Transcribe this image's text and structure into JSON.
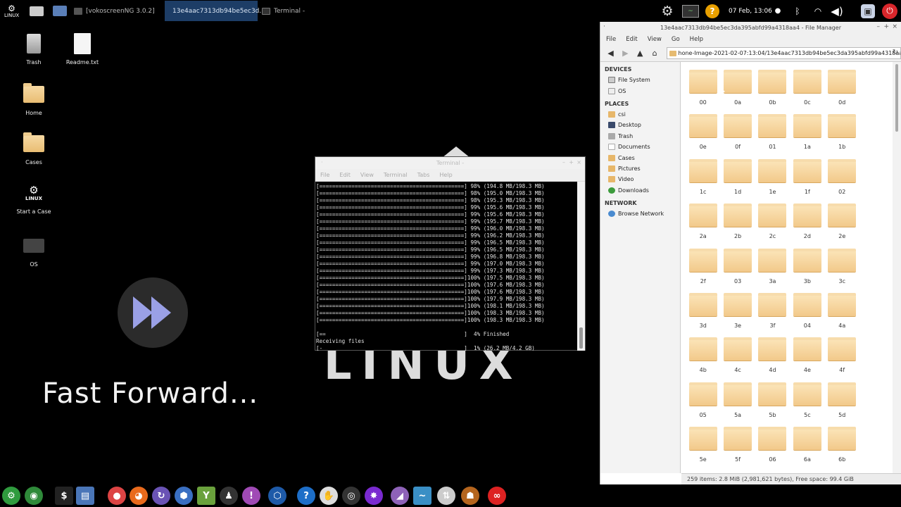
{
  "top_panel": {
    "logo_text": "LINUX",
    "tasks": [
      {
        "label": "[vokoscreenNG 3.0.2]",
        "active": false
      },
      {
        "label": "13e4aac7313db94be5ec3d...",
        "active": true
      },
      {
        "label": "Terminal -",
        "active": false
      }
    ],
    "datetime": "07 Feb, 13:06"
  },
  "desktop_icons": [
    {
      "label": "Trash"
    },
    {
      "label": "Readme.txt"
    },
    {
      "label": "Home"
    },
    {
      "label": "Cases"
    },
    {
      "label": "Start a Case"
    },
    {
      "label": "OS"
    }
  ],
  "overlay": {
    "text": "Fast Forward..."
  },
  "background_logo": "LINUX",
  "terminal": {
    "title": "Terminal -",
    "menu": [
      "File",
      "Edit",
      "View",
      "Terminal",
      "Tabs",
      "Help"
    ],
    "lines": [
      "[=============================================] 98% (194.8 MB/198.3 MB)",
      "[=============================================] 98% (195.0 MB/198.3 MB)",
      "[=============================================] 98% (195.3 MB/198.3 MB)",
      "[=============================================] 99% (195.6 MB/198.3 MB)",
      "[=============================================] 99% (195.6 MB/198.3 MB)",
      "[=============================================] 99% (195.7 MB/198.3 MB)",
      "[=============================================] 99% (196.0 MB/198.3 MB)",
      "[=============================================] 99% (196.2 MB/198.3 MB)",
      "[=============================================] 99% (196.5 MB/198.3 MB)",
      "[=============================================] 99% (196.5 MB/198.3 MB)",
      "[=============================================] 99% (196.8 MB/198.3 MB)",
      "[=============================================] 99% (197.0 MB/198.3 MB)",
      "[=============================================] 99% (197.3 MB/198.3 MB)",
      "[=============================================]100% (197.5 MB/198.3 MB)",
      "[=============================================]100% (197.6 MB/198.3 MB)",
      "[=============================================]100% (197.6 MB/198.3 MB)",
      "[=============================================]100% (197.9 MB/198.3 MB)",
      "[=============================================]100% (198.1 MB/198.3 MB)",
      "[=============================================]100% (198.3 MB/198.3 MB)",
      "[=============================================]100% (198.3 MB/198.3 MB)",
      "",
      "[==                                           ]  4% Finished",
      "Receiving files",
      "[-                                            ]  1% (26.2 MB/4.2 GB)"
    ]
  },
  "file_manager": {
    "title": "13e4aac7313db94be5ec3da395abfd99a4318aa4 - File Manager",
    "menu": [
      "File",
      "Edit",
      "View",
      "Go",
      "Help"
    ],
    "path": "hone-Image-2021-02-07:13:04/13e4aac7313db94be5ec3da395abfd99a4318aa4/",
    "sidebar": {
      "devices_header": "DEVICES",
      "devices": [
        "File System",
        "OS"
      ],
      "places_header": "PLACES",
      "places": [
        "csi",
        "Desktop",
        "Trash",
        "Documents",
        "Cases",
        "Pictures",
        "Video",
        "Downloads"
      ],
      "network_header": "NETWORK",
      "network": [
        "Browse Network"
      ]
    },
    "folders": [
      "00",
      "0a",
      "0b",
      "0c",
      "0d",
      "0e",
      "0f",
      "01",
      "1a",
      "1b",
      "1c",
      "1d",
      "1e",
      "1f",
      "02",
      "2a",
      "2b",
      "2c",
      "2d",
      "2e",
      "2f",
      "03",
      "3a",
      "3b",
      "3c",
      "3d",
      "3e",
      "3f",
      "04",
      "4a",
      "4b",
      "4c",
      "4d",
      "4e",
      "4f",
      "05",
      "5a",
      "5b",
      "5c",
      "5d",
      "5e",
      "5f",
      "06",
      "6a",
      "6b"
    ],
    "status": "259 items: 2.8 MiB (2,981,621 bytes), Free space: 99.4 GiB"
  },
  "dock_icons": [
    "settings-icon",
    "browser-icon",
    "terminal-icon",
    "files-icon",
    "chrome-icon",
    "firefox-icon",
    "sync-icon",
    "network-icon",
    "tool-icon",
    "user-icon",
    "alert-icon",
    "app-icon",
    "info-icon",
    "hands-icon",
    "globe-icon",
    "spider-icon",
    "wine-icon",
    "graph-icon",
    "sort-icon",
    "bug-icon",
    "infinity-icon"
  ]
}
